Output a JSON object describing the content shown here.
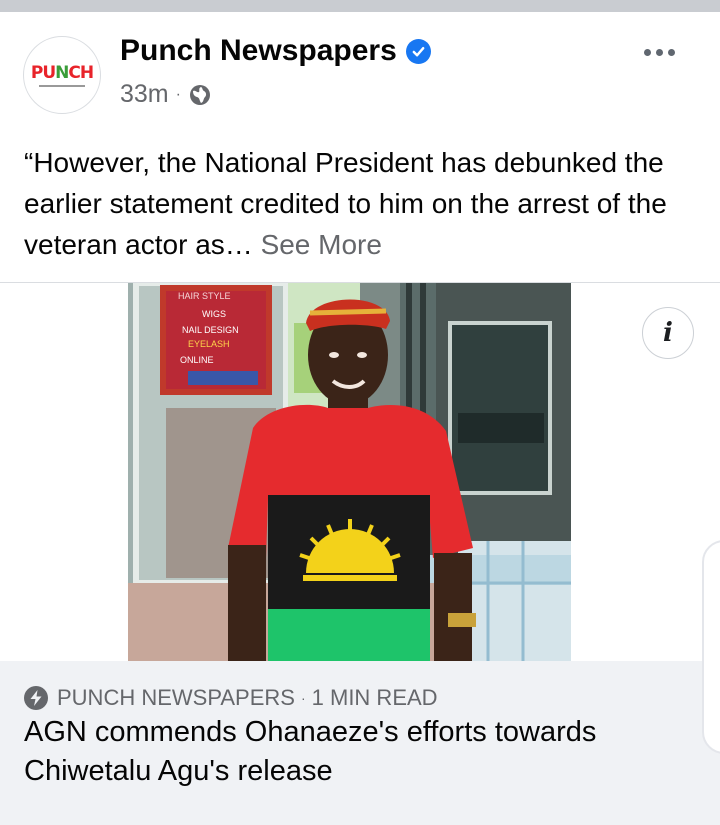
{
  "post": {
    "author": "Punch Newspapers",
    "avatar_text": "PUNCH",
    "timestamp": "33m",
    "separator": "·",
    "text": "“However, the National President has debunked the earlier statement credited to him on the arrest of the veteran actor as…",
    "see_more": "See More"
  },
  "link_preview": {
    "source": "PUNCH NEWSPAPERS",
    "separator": "·",
    "read_time": "1 MIN READ",
    "title": "AGN commends Ohanaeze's efforts towards Chiwetalu Agu's release"
  },
  "photo": {
    "shop_sign_lines": [
      "HAIR STYLE",
      "WIGS",
      "NAIL DESIGN",
      "EYELASH",
      "ONLINE"
    ],
    "info_label": "i"
  },
  "colors": {
    "verified": "#1877f2",
    "secondary_text": "#65676b",
    "card_background": "#f0f2f5",
    "shirt_red": "#e52b2e",
    "shirt_black": "#1a1a1a",
    "shirt_green": "#1ec46a",
    "emblem_yellow": "#f3d21a"
  },
  "icons": {
    "verified": "verified-badge-icon",
    "audience": "globe-icon",
    "menu": "more-horizontal-icon",
    "info": "info-icon",
    "instant_article": "lightning-bolt-icon"
  }
}
